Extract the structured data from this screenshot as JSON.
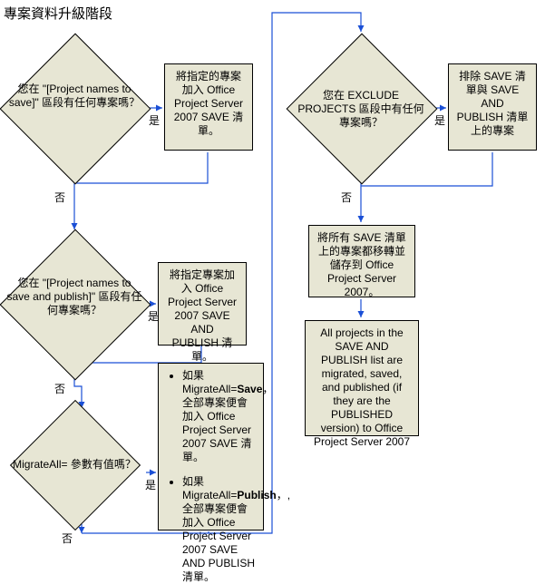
{
  "title": "專案資料升級階段",
  "labels": {
    "yes": "是",
    "no": "否"
  },
  "left": {
    "d1": "您在 \"[Project names to save]\" 區段有任何專案嗎？",
    "r1": "將指定的專案加入 Office Project Server 2007 SAVE 清單。",
    "d2": "您在 \"[Project names to save and publish]\" 區段有任何專案嗎？",
    "r2": "將指定專案加入 Office Project Server 2007 SAVE AND PUBLISH 清單。",
    "d3": "MigrateAll= 參數有值嗎？",
    "r3a_pre": "如果 MigrateAll=",
    "r3a_b": "Save",
    "r3a_post": "，全部專案便會加入 Office  Project Server 2007 SAVE 清單。",
    "r3b_pre": "如果 MigrateAll=",
    "r3b_b": "Publish",
    "r3b_post": "，,全部專案便會加入 Office  Project Server 2007 SAVE AND PUBLISH 清單。"
  },
  "right": {
    "d1": "您在 EXCLUDE PROJECTS 區段中有任何專案嗎？",
    "r1": "排除 SAVE 清單與 SAVE AND PUBLISH 清單上的專案",
    "r2": "將所有 SAVE 清單上的專案都移轉並儲存到 Office Project Server 2007。",
    "r3": "All projects in the SAVE AND PUBLISH list are migrated, saved, and published (if they are the PUBLISHED version) to Office Project Server 2007"
  }
}
